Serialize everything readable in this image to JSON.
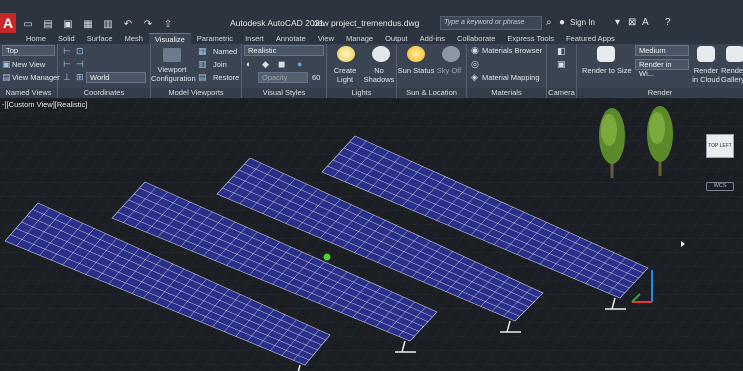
{
  "titlebar": {
    "logo": "A",
    "app_name": "Autodesk AutoCAD 2021",
    "file_name": "new project_tremendus.dwg",
    "search_placeholder": "Type a keyword or phrase",
    "sign_in": "Sign In"
  },
  "tabs": [
    "Home",
    "Solid",
    "Surface",
    "Mesh",
    "Visualize",
    "Parametric",
    "Insert",
    "Annotate",
    "View",
    "Manage",
    "Output",
    "Add-ins",
    "Collaborate",
    "Express Tools",
    "Featured Apps"
  ],
  "active_tab": "Visualize",
  "ribbon": {
    "named_views": {
      "top_dropdown": "Top",
      "new_view": "New View",
      "view_manager": "View Manager",
      "title": "Named Views"
    },
    "coordinates": {
      "world_dropdown": "World",
      "title": "Coordinates"
    },
    "model_viewports": {
      "viewport_config": "Viewport Configuration",
      "named": "Named",
      "join": "Join",
      "restore": "Restore",
      "title": "Model Viewports"
    },
    "visual_styles": {
      "style_dropdown": "Realistic",
      "opacity_label": "Opacity",
      "opacity_value": "60",
      "title": "Visual Styles"
    },
    "lights": {
      "create_light": "Create Light",
      "no_shadows": "No Shadows",
      "title": "Lights"
    },
    "sun_location": {
      "sun_status": "Sun Status",
      "sky_off": "Sky Off",
      "title": "Sun & Location"
    },
    "materials": {
      "materials_browser": "Materials Browser",
      "material_mapping": "Material Mapping",
      "title": "Materials"
    },
    "camera": {
      "title": "Camera"
    },
    "render": {
      "render_to_size": "Render to Size",
      "quality_dropdown": "Medium",
      "render_in_window": "Render in Wi...",
      "render_in_cloud": "Render in Cloud",
      "render_gallery": "Render Gallery",
      "title": "Render"
    }
  },
  "viewport": {
    "label": "-][Custom View][Realistic]",
    "viewcube_face": "TOP LEFT",
    "wcs": "WCS"
  },
  "colors": {
    "panel_blue": "#2a2f8a",
    "panel_grid": "#ffffff",
    "ground": "#1b1f24",
    "tree": "#5a8a2a",
    "accent_red": "#c62828"
  }
}
